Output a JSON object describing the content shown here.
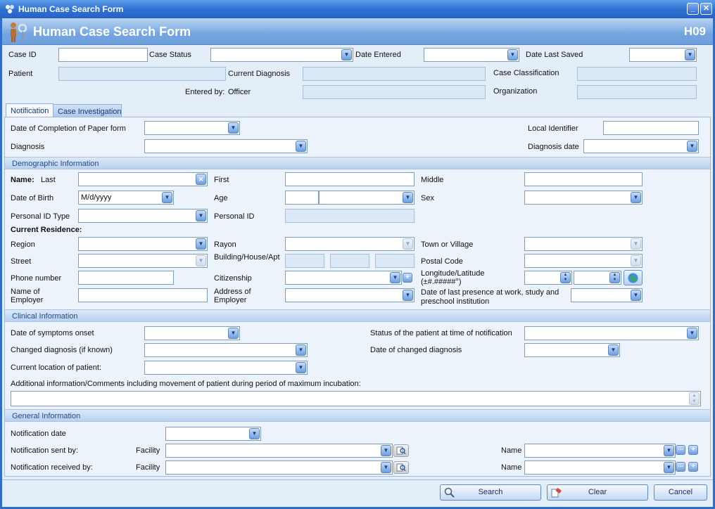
{
  "window": {
    "title": "Human Case Search Form",
    "header_title": "Human Case Search Form",
    "header_code": "H09",
    "minimize_glyph": "_",
    "close_glyph": "✕"
  },
  "top": {
    "case_id_label": "Case ID",
    "case_status_label": "Case Status",
    "date_entered_label": "Date Entered",
    "date_last_saved_label": "Date Last Saved",
    "patient_label": "Patient",
    "current_diagnosis_label": "Current Diagnosis",
    "case_classification_label": "Case Classification",
    "entered_by_label": "Entered by:",
    "officer_label": "Officer",
    "organization_label": "Organization"
  },
  "tabs": [
    "Notification",
    "Case Investigation"
  ],
  "notification": {
    "date_completion_label": "Date of Completion of Paper form",
    "local_identifier_label": "Local Identifier",
    "diagnosis_label": "Diagnosis",
    "diagnosis_date_label": "Diagnosis date"
  },
  "demographic": {
    "section_title": "Demographic Information",
    "name_label": "Name:",
    "last_label": "Last",
    "first_label": "First",
    "middle_label": "Middle",
    "dob_label": "Date of Birth",
    "dob_value": "M/d/yyyy",
    "age_label": "Age",
    "sex_label": "Sex",
    "personal_id_type_label": "Personal ID Type",
    "personal_id_label": "Personal ID",
    "current_residence_label": "Current Residence:",
    "region_label": "Region",
    "rayon_label": "Rayon",
    "town_label": "Town or Village",
    "street_label": "Street",
    "building_label": "Building/House/Apt",
    "postal_code_label": "Postal Code",
    "phone_label": "Phone number",
    "citizenship_label": "Citizenship",
    "longlat_label": "Longitude/Latitude",
    "longlat_format": "(±#.#####°)",
    "employer_name_label_1": "Name of",
    "employer_name_label_2": "Employer",
    "employer_address_label_1": "Address of",
    "employer_address_label_2": "Employer",
    "last_presence_label_1": "Date of last presence at work, study and",
    "last_presence_label_2": "preschool institution"
  },
  "clinical": {
    "section_title": "Clinical Information",
    "symptoms_onset_label": "Date of symptoms onset",
    "status_label": "Status of the patient at time of notification",
    "changed_diagnosis_label": "Changed diagnosis (if known)",
    "date_changed_diagnosis_label": "Date of changed diagnosis",
    "current_location_label": "Current location of patient:",
    "additional_info_label": "Additional information/Comments including movement of patient during period of maximum incubation:"
  },
  "general": {
    "section_title": "General Information",
    "notification_date_label": "Notification date",
    "sent_by_label": "Notification sent by:",
    "received_by_label": "Notification received by:",
    "facility_label": "Facility",
    "name_label": "Name"
  },
  "buttons": {
    "search": "Search",
    "clear": "Clear",
    "cancel": "Cancel"
  },
  "icons": {
    "dropdown": "▼",
    "clear_x": "✕",
    "ellipsis": "···",
    "plus": "+"
  },
  "colors": {
    "titlebar": "#2f72d3",
    "header": "#74a5e0",
    "readonly_field": "#dbe8f7",
    "section_header": "#b9d1ef"
  }
}
